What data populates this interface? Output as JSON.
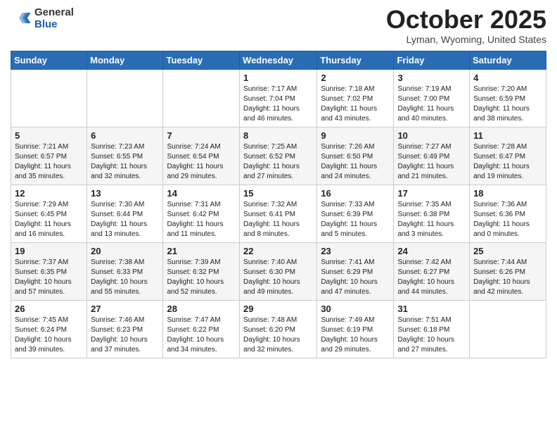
{
  "header": {
    "logo_general": "General",
    "logo_blue": "Blue",
    "title": "October 2025",
    "subtitle": "Lyman, Wyoming, United States"
  },
  "days_of_week": [
    "Sunday",
    "Monday",
    "Tuesday",
    "Wednesday",
    "Thursday",
    "Friday",
    "Saturday"
  ],
  "weeks": [
    [
      {
        "day": "",
        "info": ""
      },
      {
        "day": "",
        "info": ""
      },
      {
        "day": "",
        "info": ""
      },
      {
        "day": "1",
        "info": "Sunrise: 7:17 AM\nSunset: 7:04 PM\nDaylight: 11 hours and 46 minutes."
      },
      {
        "day": "2",
        "info": "Sunrise: 7:18 AM\nSunset: 7:02 PM\nDaylight: 11 hours and 43 minutes."
      },
      {
        "day": "3",
        "info": "Sunrise: 7:19 AM\nSunset: 7:00 PM\nDaylight: 11 hours and 40 minutes."
      },
      {
        "day": "4",
        "info": "Sunrise: 7:20 AM\nSunset: 6:59 PM\nDaylight: 11 hours and 38 minutes."
      }
    ],
    [
      {
        "day": "5",
        "info": "Sunrise: 7:21 AM\nSunset: 6:57 PM\nDaylight: 11 hours and 35 minutes."
      },
      {
        "day": "6",
        "info": "Sunrise: 7:23 AM\nSunset: 6:55 PM\nDaylight: 11 hours and 32 minutes."
      },
      {
        "day": "7",
        "info": "Sunrise: 7:24 AM\nSunset: 6:54 PM\nDaylight: 11 hours and 29 minutes."
      },
      {
        "day": "8",
        "info": "Sunrise: 7:25 AM\nSunset: 6:52 PM\nDaylight: 11 hours and 27 minutes."
      },
      {
        "day": "9",
        "info": "Sunrise: 7:26 AM\nSunset: 6:50 PM\nDaylight: 11 hours and 24 minutes."
      },
      {
        "day": "10",
        "info": "Sunrise: 7:27 AM\nSunset: 6:49 PM\nDaylight: 11 hours and 21 minutes."
      },
      {
        "day": "11",
        "info": "Sunrise: 7:28 AM\nSunset: 6:47 PM\nDaylight: 11 hours and 19 minutes."
      }
    ],
    [
      {
        "day": "12",
        "info": "Sunrise: 7:29 AM\nSunset: 6:45 PM\nDaylight: 11 hours and 16 minutes."
      },
      {
        "day": "13",
        "info": "Sunrise: 7:30 AM\nSunset: 6:44 PM\nDaylight: 11 hours and 13 minutes."
      },
      {
        "day": "14",
        "info": "Sunrise: 7:31 AM\nSunset: 6:42 PM\nDaylight: 11 hours and 11 minutes."
      },
      {
        "day": "15",
        "info": "Sunrise: 7:32 AM\nSunset: 6:41 PM\nDaylight: 11 hours and 8 minutes."
      },
      {
        "day": "16",
        "info": "Sunrise: 7:33 AM\nSunset: 6:39 PM\nDaylight: 11 hours and 5 minutes."
      },
      {
        "day": "17",
        "info": "Sunrise: 7:35 AM\nSunset: 6:38 PM\nDaylight: 11 hours and 3 minutes."
      },
      {
        "day": "18",
        "info": "Sunrise: 7:36 AM\nSunset: 6:36 PM\nDaylight: 11 hours and 0 minutes."
      }
    ],
    [
      {
        "day": "19",
        "info": "Sunrise: 7:37 AM\nSunset: 6:35 PM\nDaylight: 10 hours and 57 minutes."
      },
      {
        "day": "20",
        "info": "Sunrise: 7:38 AM\nSunset: 6:33 PM\nDaylight: 10 hours and 55 minutes."
      },
      {
        "day": "21",
        "info": "Sunrise: 7:39 AM\nSunset: 6:32 PM\nDaylight: 10 hours and 52 minutes."
      },
      {
        "day": "22",
        "info": "Sunrise: 7:40 AM\nSunset: 6:30 PM\nDaylight: 10 hours and 49 minutes."
      },
      {
        "day": "23",
        "info": "Sunrise: 7:41 AM\nSunset: 6:29 PM\nDaylight: 10 hours and 47 minutes."
      },
      {
        "day": "24",
        "info": "Sunrise: 7:42 AM\nSunset: 6:27 PM\nDaylight: 10 hours and 44 minutes."
      },
      {
        "day": "25",
        "info": "Sunrise: 7:44 AM\nSunset: 6:26 PM\nDaylight: 10 hours and 42 minutes."
      }
    ],
    [
      {
        "day": "26",
        "info": "Sunrise: 7:45 AM\nSunset: 6:24 PM\nDaylight: 10 hours and 39 minutes."
      },
      {
        "day": "27",
        "info": "Sunrise: 7:46 AM\nSunset: 6:23 PM\nDaylight: 10 hours and 37 minutes."
      },
      {
        "day": "28",
        "info": "Sunrise: 7:47 AM\nSunset: 6:22 PM\nDaylight: 10 hours and 34 minutes."
      },
      {
        "day": "29",
        "info": "Sunrise: 7:48 AM\nSunset: 6:20 PM\nDaylight: 10 hours and 32 minutes."
      },
      {
        "day": "30",
        "info": "Sunrise: 7:49 AM\nSunset: 6:19 PM\nDaylight: 10 hours and 29 minutes."
      },
      {
        "day": "31",
        "info": "Sunrise: 7:51 AM\nSunset: 6:18 PM\nDaylight: 10 hours and 27 minutes."
      },
      {
        "day": "",
        "info": ""
      }
    ]
  ]
}
